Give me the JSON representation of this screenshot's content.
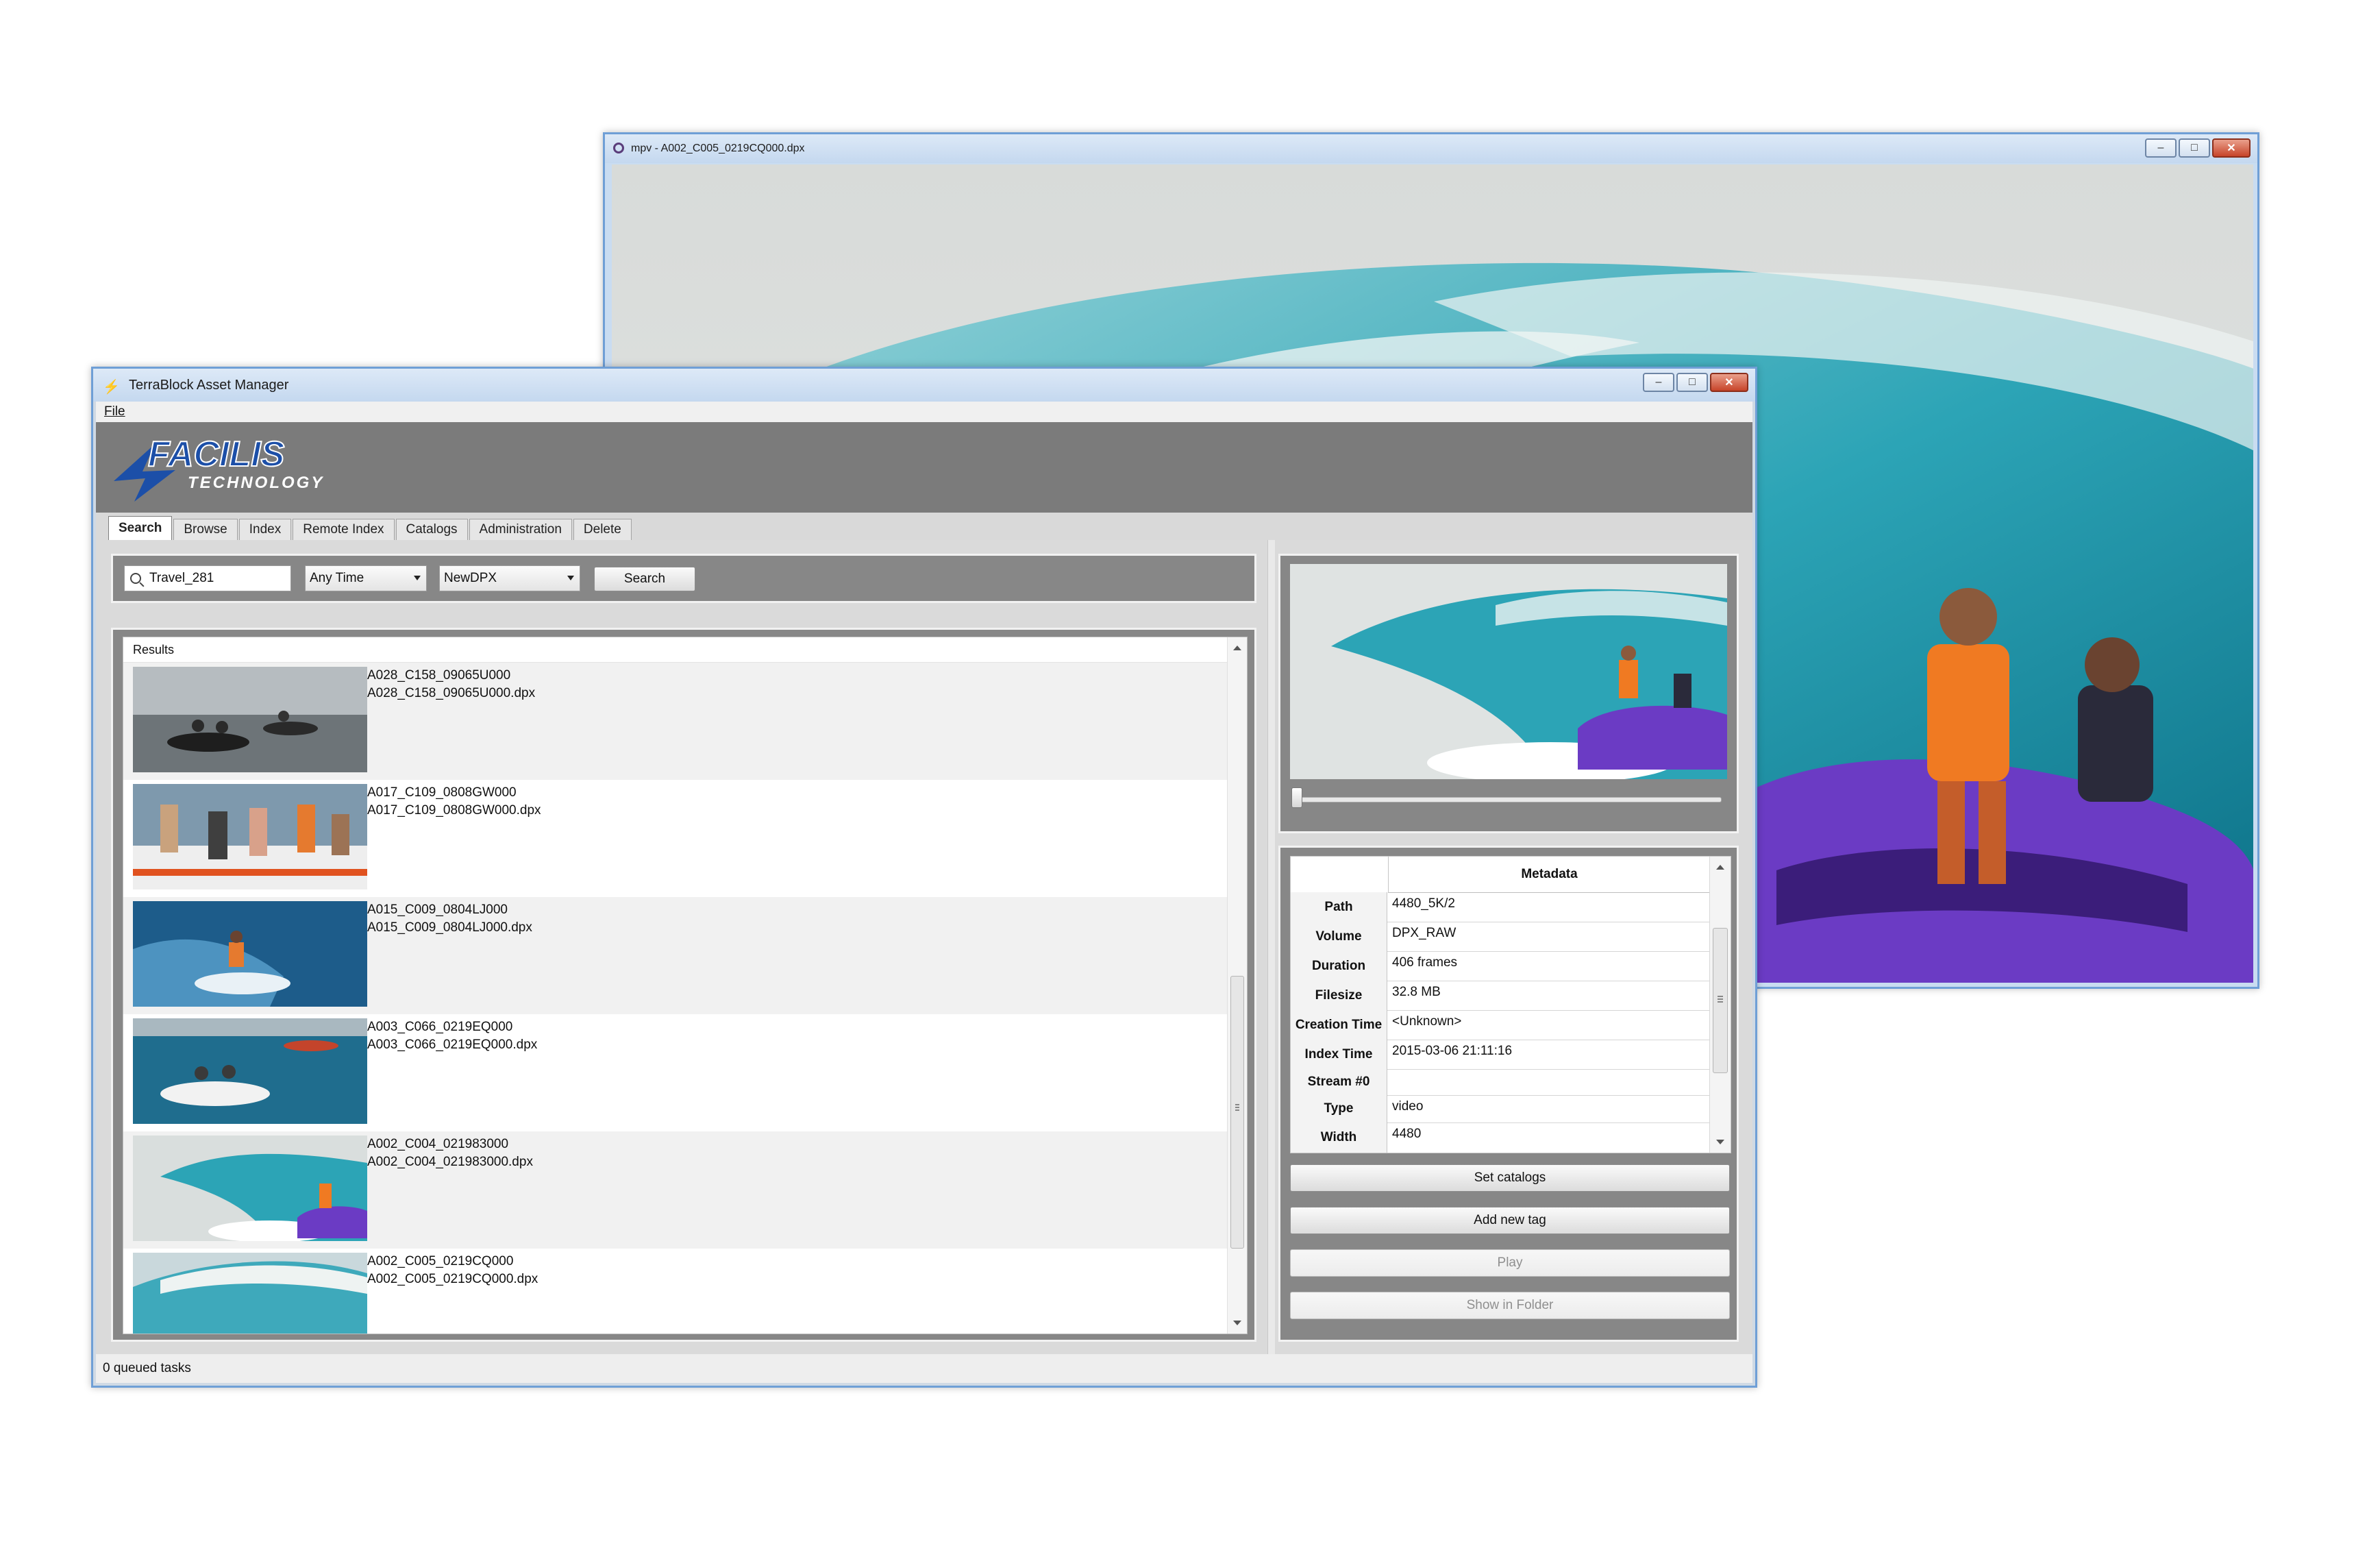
{
  "mpv": {
    "title": "mpv - A002_C005_0219CQ000.dpx",
    "controls": {
      "minimize": "–",
      "maximize": "□",
      "close": "✕"
    }
  },
  "app": {
    "title": "TerraBlock Asset Manager",
    "menu": {
      "file": "File"
    },
    "logo": {
      "brand": "FACILIS",
      "sub": "TECHNOLOGY",
      "brand_color": "#1c4fa8"
    },
    "controls": {
      "minimize": "–",
      "maximize": "□",
      "close": "✕"
    },
    "tabs": [
      {
        "label": "Search",
        "active": true
      },
      {
        "label": "Browse"
      },
      {
        "label": "Index"
      },
      {
        "label": "Remote Index"
      },
      {
        "label": "Catalogs"
      },
      {
        "label": "Administration"
      },
      {
        "label": "Delete"
      }
    ],
    "status": "0 queued tasks"
  },
  "search": {
    "query": "Travel_281",
    "time_filter": "Any Time",
    "catalog": "NewDPX",
    "button": "Search"
  },
  "results": {
    "header": "Results",
    "items": [
      {
        "name": "A028_C158_09065U000",
        "file": "A028_C158_09065U000.dpx",
        "thumb": "jetski-group-icon"
      },
      {
        "name": "A017_C109_0808GW000",
        "file": "A017_C109_0808GW000.dpx",
        "thumb": "boat-crew-icon"
      },
      {
        "name": "A015_C009_0804LJ000",
        "file": "A015_C009_0804LJ000.dpx",
        "thumb": "surfer-icon"
      },
      {
        "name": "A003_C066_0219EQ000",
        "file": "A003_C066_0219EQ000.dpx",
        "thumb": "jetski-sea-icon"
      },
      {
        "name": "A002_C004_021983000",
        "file": "A002_C004_021983000.dpx",
        "thumb": "wave-jetski-icon"
      },
      {
        "name": "A002_C005_0219CQ000",
        "file": "A002_C005_0219CQ000.dpx",
        "thumb": "wave-icon"
      }
    ]
  },
  "metadata": {
    "header": "Metadata",
    "rows": [
      {
        "key": "Path",
        "value": "4480_5K/2"
      },
      {
        "key": "Volume",
        "value": "DPX_RAW"
      },
      {
        "key": "Duration",
        "value": "406 frames"
      },
      {
        "key": "Filesize",
        "value": "32.8 MB"
      },
      {
        "key": "Creation Time",
        "value": "<Unknown>"
      },
      {
        "key": "Index Time",
        "value": "2015-03-06 21:11:16"
      },
      {
        "key": "Stream #0",
        "value": ""
      },
      {
        "key": "Type",
        "value": "video"
      },
      {
        "key": "Width",
        "value": "4480"
      }
    ]
  },
  "actions": {
    "set_catalogs": "Set catalogs",
    "add_tag": "Add new tag",
    "play": "Play",
    "show_folder": "Show in Folder"
  },
  "colors": {
    "window_border": "#6f9fd6",
    "panel_gray": "#878787",
    "banner_gray": "#7b7b7b",
    "wave_teal": "#2f9fb3",
    "jetski_purple": "#6b3bc4"
  }
}
